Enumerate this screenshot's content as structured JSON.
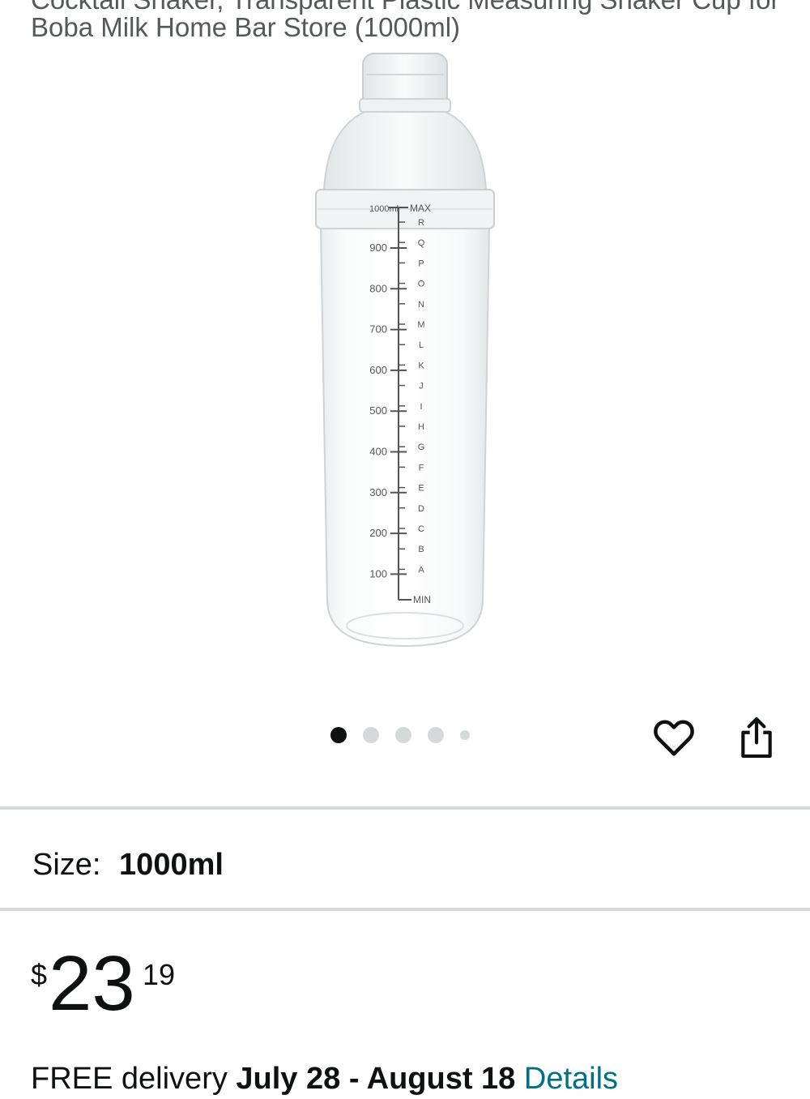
{
  "product": {
    "title_line_1": "Cocktail Shaker, Transparent Plastic Measuring Shaker Cup for",
    "title_line_2": "Boba Milk Home Bar Store (1000ml)",
    "image_alt": "Clear plastic cocktail shaker with measurement markings"
  },
  "gallery": {
    "dot_count": 5,
    "active_index": 0
  },
  "actions": {
    "favorite_icon": "heart-outline-icon",
    "share_icon": "share-icon"
  },
  "shaker_markings": {
    "top_label": "1000ml",
    "max_label": "MAX",
    "min_label": "MIN",
    "ml_marks": [
      "900",
      "800",
      "700",
      "600",
      "500",
      "400",
      "300",
      "200",
      "100"
    ],
    "letters": [
      "R",
      "Q",
      "P",
      "O",
      "N",
      "M",
      "L",
      "K",
      "J",
      "I",
      "H",
      "G",
      "F",
      "E",
      "D",
      "C",
      "B",
      "A"
    ]
  },
  "size": {
    "label": "Size:",
    "value": "1000ml"
  },
  "price": {
    "symbol": "$",
    "whole": "23",
    "fraction": "19"
  },
  "delivery": {
    "prefix": "FREE delivery",
    "dates": "July 28 - August 18",
    "details_link": "Details"
  },
  "colors": {
    "text_primary": "#0f1111",
    "text_secondary": "#565959",
    "link": "#007185",
    "divider": "#d5d9d9"
  }
}
